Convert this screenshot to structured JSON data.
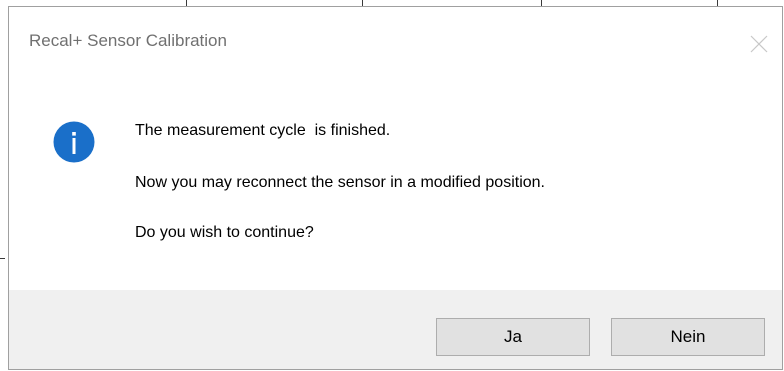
{
  "dialog": {
    "title": "Recal+ Sensor Calibration",
    "icon": "info-icon",
    "messages": [
      "The measurement cycle  is finished.",
      "Now you may reconnect the sensor in a modified position.",
      "Do you wish to continue?"
    ],
    "buttons": {
      "yes_label": "Ja",
      "no_label": "Nein"
    }
  },
  "colors": {
    "icon_blue": "#1a6fc9",
    "footer_bg": "#f0f0f0",
    "button_bg": "#e1e1e1",
    "title_text": "#707070"
  }
}
